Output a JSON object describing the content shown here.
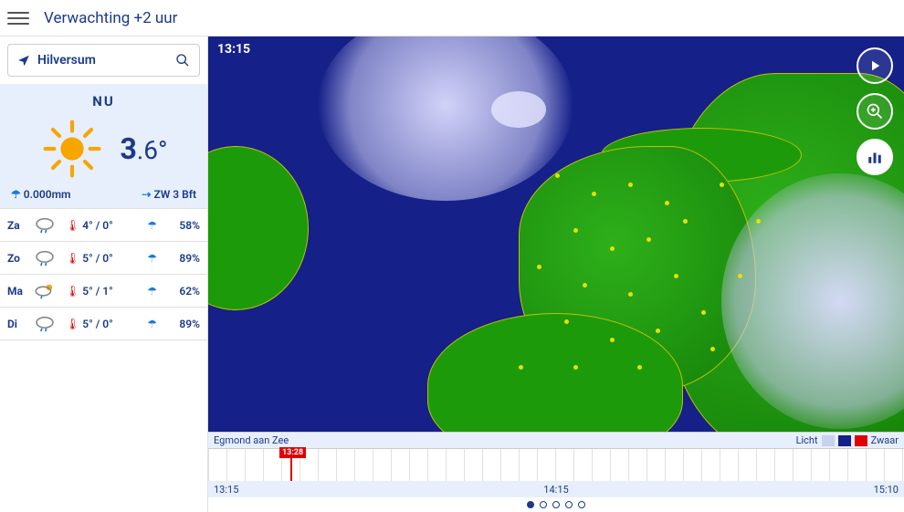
{
  "header": {
    "title": "Verwachting +2 uur"
  },
  "search": {
    "location": "Hilversum"
  },
  "now": {
    "label": "NU",
    "temp_whole": "3",
    "temp_frac": ".6°",
    "precip": "0.000mm",
    "wind": "ZW 3 Bft"
  },
  "forecast": [
    {
      "day": "Za",
      "temps": "4° / 0°",
      "prob": "58%"
    },
    {
      "day": "Zo",
      "temps": "5° / 0°",
      "prob": "89%"
    },
    {
      "day": "Ma",
      "temps": "5° / 1°",
      "prob": "62%"
    },
    {
      "day": "Di",
      "temps": "5° / 0°",
      "prob": "89%"
    }
  ],
  "map": {
    "time": "13:15",
    "location_label": "Egmond aan Zee",
    "legend_light": "Licht",
    "legend_heavy": "Zwaar",
    "marker_time": "13:28",
    "tl_start": "13:15",
    "tl_mid": "14:15",
    "tl_end": "15:10"
  }
}
